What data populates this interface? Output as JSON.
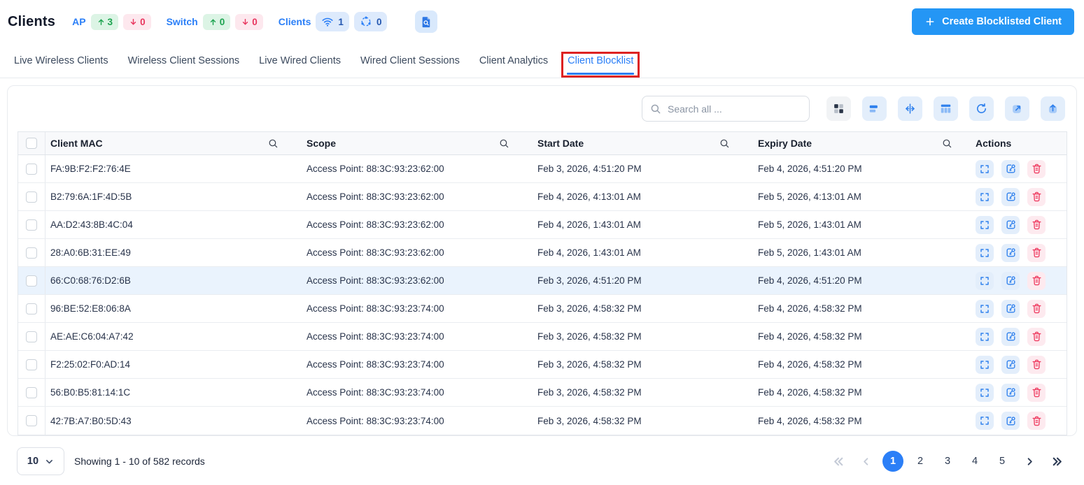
{
  "header": {
    "title": "Clients",
    "device_groups": [
      {
        "label": "AP",
        "up": "3",
        "down": "0"
      },
      {
        "label": "Switch",
        "up": "0",
        "down": "0"
      }
    ],
    "clients_summary": {
      "label": "Clients",
      "wireless_count": "1",
      "mesh_count": "0"
    },
    "create_button_label": "Create Blocklisted Client"
  },
  "tabs": [
    {
      "label": "Live Wireless Clients",
      "active": false,
      "annotated": false
    },
    {
      "label": "Wireless Client Sessions",
      "active": false,
      "annotated": false
    },
    {
      "label": "Live Wired Clients",
      "active": false,
      "annotated": false
    },
    {
      "label": "Wired Client Sessions",
      "active": false,
      "annotated": false
    },
    {
      "label": "Client Analytics",
      "active": false,
      "annotated": false
    },
    {
      "label": "Client Blocklist",
      "active": true,
      "annotated": true
    }
  ],
  "toolbar": {
    "search_placeholder": "Search all ...",
    "buttons": [
      "tiles-view",
      "list-view",
      "fit-columns",
      "manage-columns",
      "refresh",
      "open-expand",
      "export"
    ]
  },
  "table": {
    "columns": {
      "mac": "Client MAC",
      "scope": "Scope",
      "start": "Start Date",
      "expiry": "Expiry Date",
      "actions": "Actions"
    },
    "rows": [
      {
        "mac": "FA:9B:F2:F2:76:4E",
        "scope": "Access Point: 88:3C:93:23:62:00",
        "start": "Feb 3, 2026, 4:51:20 PM",
        "expiry": "Feb 4, 2026, 4:51:20 PM",
        "highlighted": false
      },
      {
        "mac": "B2:79:6A:1F:4D:5B",
        "scope": "Access Point: 88:3C:93:23:62:00",
        "start": "Feb 4, 2026, 4:13:01 AM",
        "expiry": "Feb 5, 2026, 4:13:01 AM",
        "highlighted": false
      },
      {
        "mac": "AA:D2:43:8B:4C:04",
        "scope": "Access Point: 88:3C:93:23:62:00",
        "start": "Feb 4, 2026, 1:43:01 AM",
        "expiry": "Feb 5, 2026, 1:43:01 AM",
        "highlighted": false
      },
      {
        "mac": "28:A0:6B:31:EE:49",
        "scope": "Access Point: 88:3C:93:23:62:00",
        "start": "Feb 4, 2026, 1:43:01 AM",
        "expiry": "Feb 5, 2026, 1:43:01 AM",
        "highlighted": false
      },
      {
        "mac": "66:C0:68:76:D2:6B",
        "scope": "Access Point: 88:3C:93:23:62:00",
        "start": "Feb 3, 2026, 4:51:20 PM",
        "expiry": "Feb 4, 2026, 4:51:20 PM",
        "highlighted": true
      },
      {
        "mac": "96:BE:52:E8:06:8A",
        "scope": "Access Point: 88:3C:93:23:74:00",
        "start": "Feb 3, 2026, 4:58:32 PM",
        "expiry": "Feb 4, 2026, 4:58:32 PM",
        "highlighted": false
      },
      {
        "mac": "AE:AE:C6:04:A7:42",
        "scope": "Access Point: 88:3C:93:23:74:00",
        "start": "Feb 3, 2026, 4:58:32 PM",
        "expiry": "Feb 4, 2026, 4:58:32 PM",
        "highlighted": false
      },
      {
        "mac": "F2:25:02:F0:AD:14",
        "scope": "Access Point: 88:3C:93:23:74:00",
        "start": "Feb 3, 2026, 4:58:32 PM",
        "expiry": "Feb 4, 2026, 4:58:32 PM",
        "highlighted": false
      },
      {
        "mac": "56:B0:B5:81:14:1C",
        "scope": "Access Point: 88:3C:93:23:74:00",
        "start": "Feb 3, 2026, 4:58:32 PM",
        "expiry": "Feb 4, 2026, 4:58:32 PM",
        "highlighted": false
      },
      {
        "mac": "42:7B:A7:B0:5D:43",
        "scope": "Access Point: 88:3C:93:23:74:00",
        "start": "Feb 3, 2026, 4:58:32 PM",
        "expiry": "Feb 4, 2026, 4:58:32 PM",
        "highlighted": false
      }
    ]
  },
  "pagination": {
    "page_size": "10",
    "summary": "Showing 1 - 10 of 582 records",
    "pages": [
      "1",
      "2",
      "3",
      "4",
      "5"
    ],
    "active_page": "1"
  },
  "colors": {
    "primary_blue": "#2b7ff7",
    "create_button_blue": "#2496f5",
    "light_blue_bg": "#e3eefb",
    "green_text": "#1ca34f",
    "green_bg": "#dcf4e5",
    "red_text": "#e8355e",
    "red_bg": "#fde8ee",
    "annotation_red": "#dd2222",
    "highlighted_row_bg": "#eaf3fd"
  }
}
